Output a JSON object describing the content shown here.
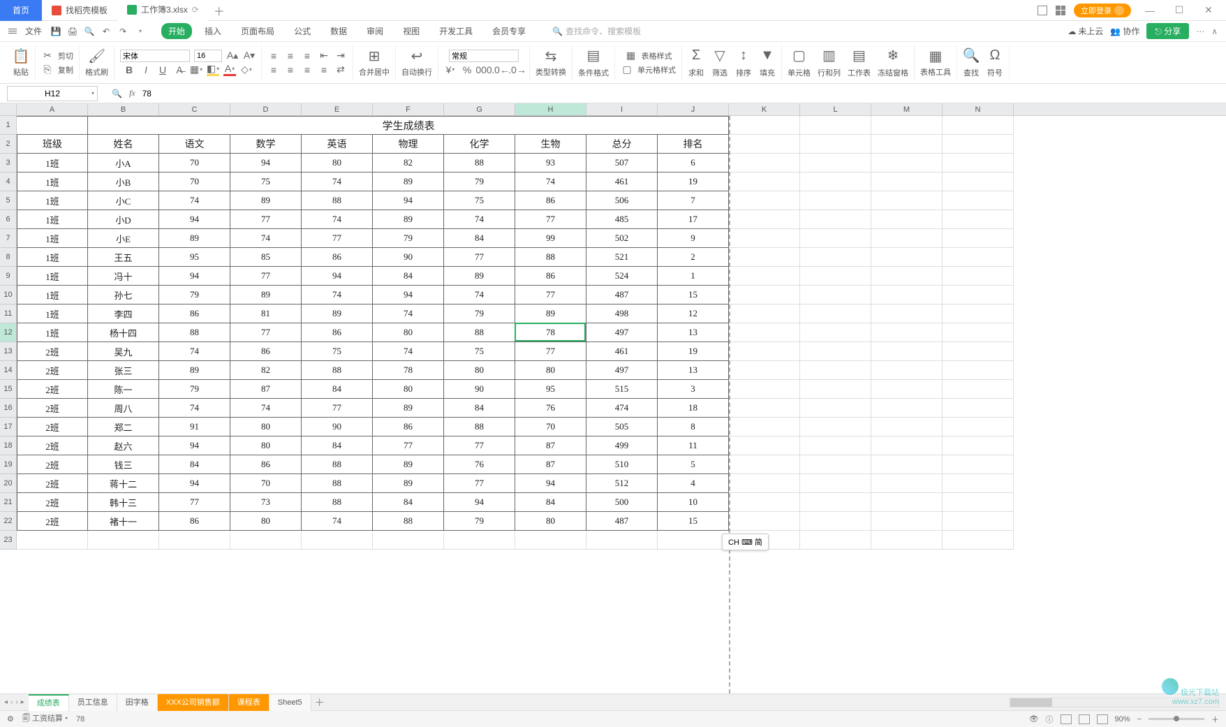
{
  "title_tabs": {
    "home": "首页",
    "template": "找稻壳模板",
    "file": "工作簿3.xlsx"
  },
  "login_btn": "立即登录",
  "menu": {
    "file": "文件",
    "tabs": [
      "开始",
      "插入",
      "页面布局",
      "公式",
      "数据",
      "审阅",
      "视图",
      "开发工具",
      "会员专享"
    ],
    "search_placeholder": "查找命令、搜索模板",
    "cloud": "未上云",
    "coop": "协作",
    "share": "分享"
  },
  "ribbon": {
    "paste": "粘贴",
    "cut": "剪切",
    "copy": "复制",
    "brush": "格式刷",
    "font_name": "宋体",
    "font_size": "16",
    "merge": "合并居中",
    "wrap": "自动换行",
    "number_fmt": "常规",
    "type_conv": "类型转换",
    "cond_fmt": "条件格式",
    "table_style": "表格样式",
    "cell_style": "单元格样式",
    "sum": "求和",
    "filter": "筛选",
    "sort": "排序",
    "fill": "填充",
    "cell": "单元格",
    "rowcol": "行和列",
    "worksheet": "工作表",
    "freeze": "冻结窗格",
    "table_tools": "表格工具",
    "find": "查找",
    "symbol": "符号"
  },
  "name_box": "H12",
  "formula_value": "78",
  "columns": [
    "A",
    "B",
    "C",
    "D",
    "E",
    "F",
    "G",
    "H",
    "I",
    "J",
    "K",
    "L",
    "M",
    "N"
  ],
  "row_count": 23,
  "selected": {
    "row": 12,
    "col": "H",
    "col_idx": 7
  },
  "table": {
    "title": "学生成绩表",
    "headers": [
      "班级",
      "姓名",
      "语文",
      "数学",
      "英语",
      "物理",
      "化学",
      "生物",
      "总分",
      "排名"
    ],
    "rows": [
      [
        "1班",
        "小A",
        "70",
        "94",
        "80",
        "82",
        "88",
        "93",
        "507",
        "6"
      ],
      [
        "1班",
        "小B",
        "70",
        "75",
        "74",
        "89",
        "79",
        "74",
        "461",
        "19"
      ],
      [
        "1班",
        "小C",
        "74",
        "89",
        "88",
        "94",
        "75",
        "86",
        "506",
        "7"
      ],
      [
        "1班",
        "小D",
        "94",
        "77",
        "74",
        "89",
        "74",
        "77",
        "485",
        "17"
      ],
      [
        "1班",
        "小E",
        "89",
        "74",
        "77",
        "79",
        "84",
        "99",
        "502",
        "9"
      ],
      [
        "1班",
        "王五",
        "95",
        "85",
        "86",
        "90",
        "77",
        "88",
        "521",
        "2"
      ],
      [
        "1班",
        "冯十",
        "94",
        "77",
        "94",
        "84",
        "89",
        "86",
        "524",
        "1"
      ],
      [
        "1班",
        "孙七",
        "79",
        "89",
        "74",
        "94",
        "74",
        "77",
        "487",
        "15"
      ],
      [
        "1班",
        "李四",
        "86",
        "81",
        "89",
        "74",
        "79",
        "89",
        "498",
        "12"
      ],
      [
        "1班",
        "杨十四",
        "88",
        "77",
        "86",
        "80",
        "88",
        "78",
        "497",
        "13"
      ],
      [
        "2班",
        "吴九",
        "74",
        "86",
        "75",
        "74",
        "75",
        "77",
        "461",
        "19"
      ],
      [
        "2班",
        "张三",
        "89",
        "82",
        "88",
        "78",
        "80",
        "80",
        "497",
        "13"
      ],
      [
        "2班",
        "陈一",
        "79",
        "87",
        "84",
        "80",
        "90",
        "95",
        "515",
        "3"
      ],
      [
        "2班",
        "周八",
        "74",
        "74",
        "77",
        "89",
        "84",
        "76",
        "474",
        "18"
      ],
      [
        "2班",
        "郑二",
        "91",
        "80",
        "90",
        "86",
        "88",
        "70",
        "505",
        "8"
      ],
      [
        "2班",
        "赵六",
        "94",
        "80",
        "84",
        "77",
        "77",
        "87",
        "499",
        "11"
      ],
      [
        "2班",
        "钱三",
        "84",
        "86",
        "88",
        "89",
        "76",
        "87",
        "510",
        "5"
      ],
      [
        "2班",
        "蒋十二",
        "94",
        "70",
        "88",
        "89",
        "77",
        "94",
        "512",
        "4"
      ],
      [
        "2班",
        "韩十三",
        "77",
        "73",
        "88",
        "84",
        "94",
        "84",
        "500",
        "10"
      ],
      [
        "2班",
        "褚十一",
        "86",
        "80",
        "74",
        "88",
        "79",
        "80",
        "487",
        "15"
      ]
    ]
  },
  "ime": "CH ⌨ 简",
  "sheet_tabs": [
    "成绩表",
    "员工信息",
    "田字格",
    "XXX公司销售额",
    "课程表",
    "Sheet5"
  ],
  "active_sheet": 0,
  "orange_sheets": [
    3,
    4
  ],
  "status": {
    "calc": "工资结算",
    "val": "78",
    "zoom": "90%"
  },
  "watermark": {
    "site": "极光下载站",
    "url": "www.xz7.com"
  }
}
